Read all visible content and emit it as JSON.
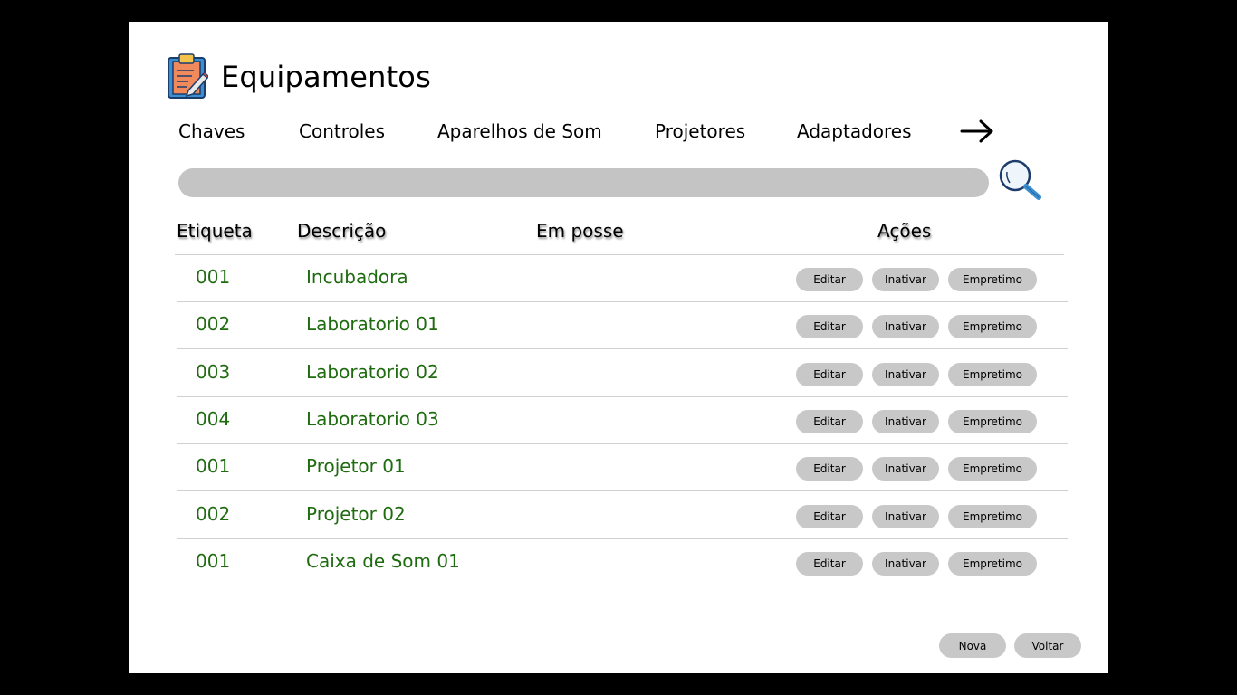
{
  "header": {
    "title": "Equipamentos",
    "logo_icon": "clipboard-pencil-icon"
  },
  "categories": [
    "Chaves",
    "Controles",
    "Aparelhos de Som",
    "Projetores",
    "Adaptadores"
  ],
  "category_next_icon": "arrow-right-icon",
  "search": {
    "value": "",
    "placeholder": "",
    "button_icon": "magnifier-icon"
  },
  "table": {
    "columns": [
      "Etiqueta",
      "Descrição",
      "Em posse",
      "Ações"
    ],
    "rows": [
      {
        "etiqueta": "001",
        "descricao": "Incubadora",
        "em_posse": ""
      },
      {
        "etiqueta": "002",
        "descricao": "Laboratorio 01",
        "em_posse": ""
      },
      {
        "etiqueta": "003",
        "descricao": "Laboratorio 02",
        "em_posse": ""
      },
      {
        "etiqueta": "004",
        "descricao": "Laboratorio 03",
        "em_posse": ""
      },
      {
        "etiqueta": "001",
        "descricao": "Projetor 01",
        "em_posse": ""
      },
      {
        "etiqueta": "002",
        "descricao": "Projetor 02",
        "em_posse": ""
      },
      {
        "etiqueta": "001",
        "descricao": "Caixa de Som 01",
        "em_posse": ""
      }
    ],
    "actions": {
      "edit": "Editar",
      "inactivate": "Inativar",
      "loan": "Empretimo"
    }
  },
  "footer": {
    "new_label": "Nova",
    "back_label": "Voltar"
  },
  "colors": {
    "background": "#000000",
    "panel": "#ffffff",
    "row_text": "#1f6b10",
    "button_bg": "#c8c8c8",
    "search_bg": "#c4c4c4"
  }
}
